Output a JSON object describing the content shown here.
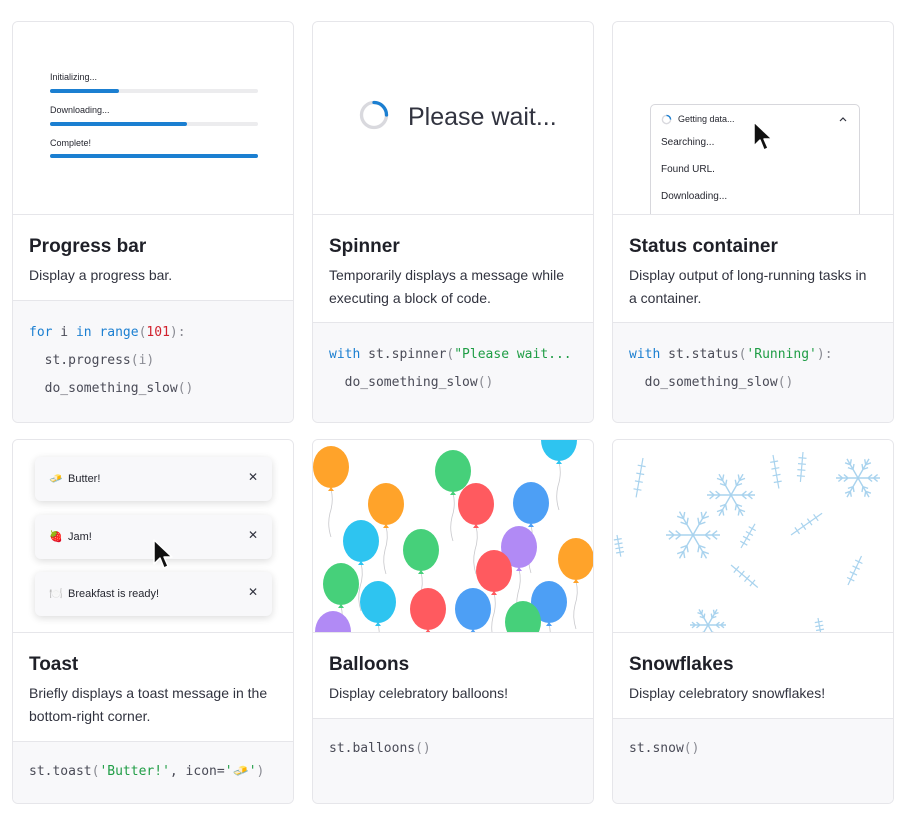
{
  "cards": [
    {
      "title": "Progress bar",
      "description": "Display a progress bar.",
      "preview": {
        "bars": [
          {
            "label": "Initializing...",
            "progress": 0.33
          },
          {
            "label": "Downloading...",
            "progress": 0.66
          },
          {
            "label": "Complete!",
            "progress": 1.0
          }
        ]
      },
      "code": {
        "kw_for": "for",
        "var_i": " i ",
        "kw_in": "in",
        "fn_range": " range",
        "p_open": "(",
        "num": "101",
        "p_close_colon": "):",
        "line2_a": "  st.progress",
        "line2_b": "(i)",
        "line3_a": "  do_something_slow",
        "line3_b": "()"
      }
    },
    {
      "title": "Spinner",
      "description": "Temporarily displays a message while executing a block of code.",
      "preview": {
        "text": "Please wait..."
      },
      "code": {
        "kw_with": "with",
        "obj": " st.spinner",
        "p_open": "(",
        "str": "\"Please wait...",
        "line2_a": "  do_something_slow",
        "line2_b": "()"
      }
    },
    {
      "title": "Status container",
      "description": "Display output of long-running tasks in a container.",
      "preview": {
        "header": "Getting data...",
        "items": [
          "Searching...",
          "Found URL.",
          "Downloading..."
        ]
      },
      "code": {
        "kw_with": "with",
        "obj": " st.status",
        "p_open": "(",
        "str": "'Running'",
        "p_close_colon": "):",
        "line2_a": "  do_something_slow",
        "line2_b": "()"
      }
    },
    {
      "title": "Toast",
      "description": "Briefly displays a toast message in the bottom-right corner.",
      "preview": {
        "toasts": [
          {
            "icon": "🧈",
            "text": "Butter!"
          },
          {
            "icon": "🍓",
            "text": "Jam!"
          },
          {
            "icon": "🍽️",
            "text": "Breakfast is ready!"
          }
        ],
        "close_glyph": "✕"
      },
      "code": {
        "obj": "st.toast",
        "p_open": "(",
        "str1": "'Butter!'",
        "sep": ", icon=",
        "str2": "'🧈'",
        "p_close": ")"
      }
    },
    {
      "title": "Balloons",
      "description": "Display celebratory balloons!",
      "code": {
        "obj": "st.balloons",
        "par": "()"
      }
    },
    {
      "title": "Snowflakes",
      "description": "Display celebratory snowflakes!",
      "code": {
        "obj": "st.snow",
        "par": "()"
      }
    }
  ],
  "colors": {
    "accent": "#1b7fd1",
    "balloons": [
      "#ffa32a",
      "#46d07a",
      "#ff5a5f",
      "#2ec4f0",
      "#b18af5",
      "#4d9ff5"
    ],
    "snow": "#a9d3ee"
  }
}
